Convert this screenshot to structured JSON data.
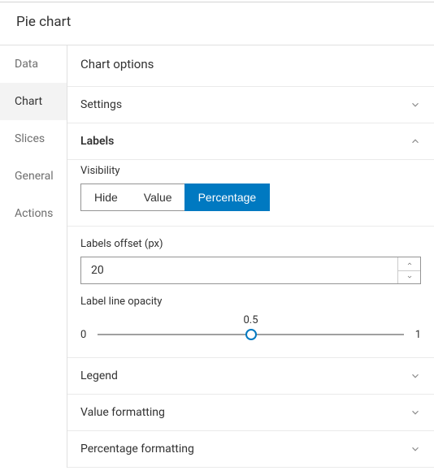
{
  "title": "Pie chart",
  "sidebar": {
    "items": [
      {
        "label": "Data"
      },
      {
        "label": "Chart"
      },
      {
        "label": "Slices"
      },
      {
        "label": "General"
      },
      {
        "label": "Actions"
      }
    ]
  },
  "content": {
    "title": "Chart options",
    "sections": {
      "settings": {
        "label": "Settings"
      },
      "labels": {
        "label": "Labels",
        "visibility_label": "Visibility",
        "visibility_options": {
          "hide": "Hide",
          "value": "Value",
          "percentage": "Percentage"
        },
        "offset_label": "Labels offset (px)",
        "offset_value": "20",
        "opacity_label": "Label line opacity",
        "opacity_value": "0.5",
        "opacity_min": "0",
        "opacity_max": "1"
      },
      "legend": {
        "label": "Legend"
      },
      "value_formatting": {
        "label": "Value formatting"
      },
      "percentage_formatting": {
        "label": "Percentage formatting"
      }
    }
  }
}
